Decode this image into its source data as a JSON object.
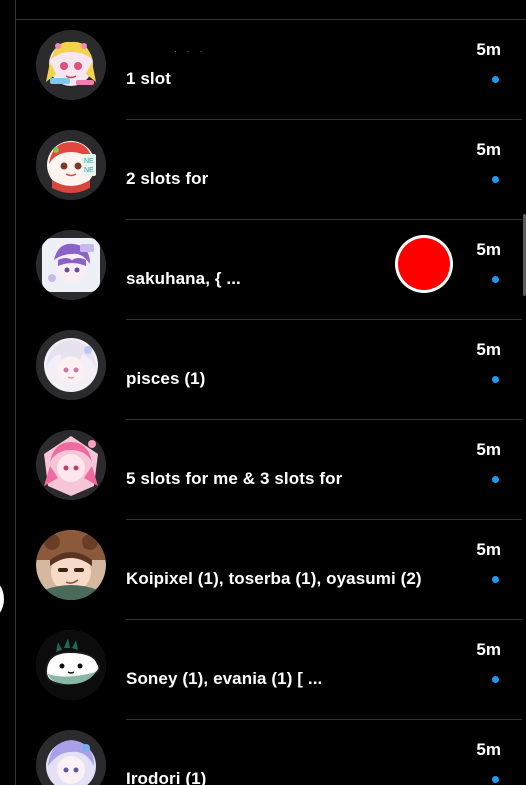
{
  "rows": [
    {
      "text": "1 slot",
      "time": "5m",
      "avatar_icon": "anime-avatar-blonde-icon"
    },
    {
      "text": "2 slots for",
      "time": "5m",
      "avatar_icon": "anime-avatar-red-icon"
    },
    {
      "text": "sakuhana, { ...",
      "time": "5m",
      "avatar_icon": "anime-avatar-purple-icon"
    },
    {
      "text": "pisces (1)",
      "time": "5m",
      "avatar_icon": "anime-avatar-white-icon"
    },
    {
      "text": "5 slots for me & 3 slots for",
      "time": "5m",
      "avatar_icon": "anime-avatar-pink-icon"
    },
    {
      "text": "Koipixel (1), toserba (1), oyasumi (2)",
      "time": "5m",
      "avatar_icon": "anime-avatar-raccoon-icon"
    },
    {
      "text": "Soney (1), evania (1) [ ...",
      "time": "5m",
      "avatar_icon": "whale-avatar-icon"
    },
    {
      "text": "Irodori (1)",
      "time": "5m",
      "avatar_icon": "anime-avatar-lavender-icon"
    }
  ],
  "colors": {
    "background": "#000000",
    "divider": "#2f3336",
    "unread_dot": "#1d9bf0",
    "record": "#ff0000"
  }
}
